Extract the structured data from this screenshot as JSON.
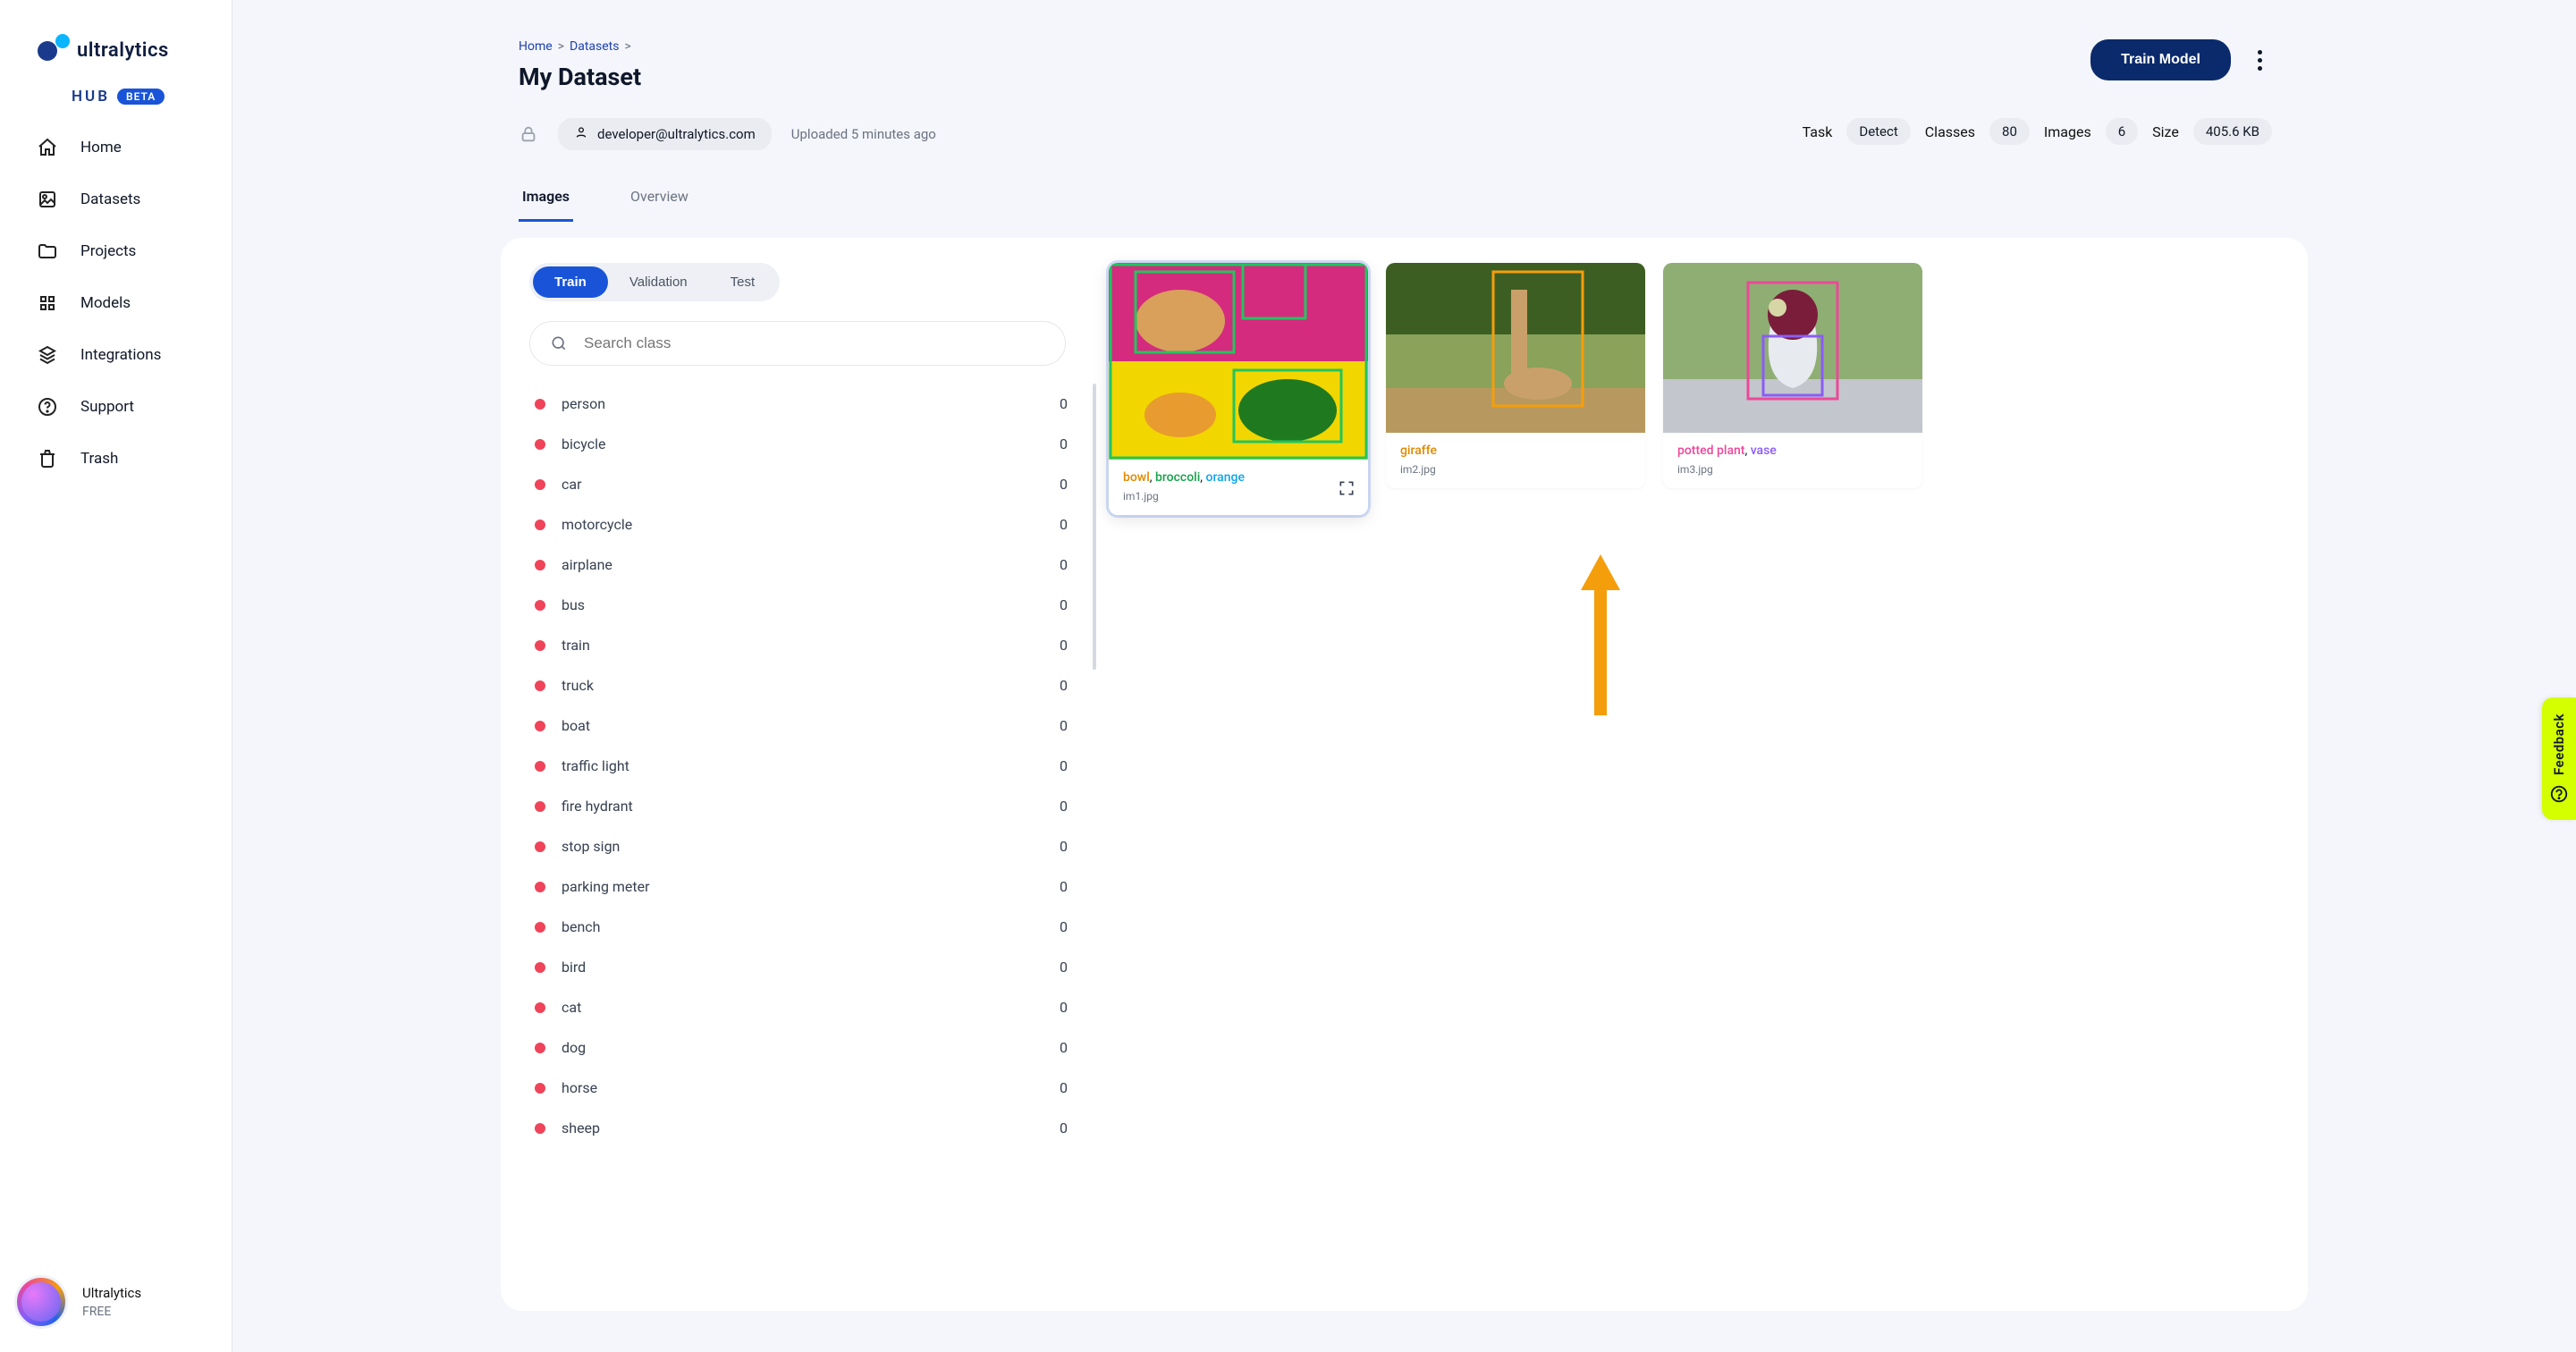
{
  "brand": {
    "name": "ultralytics",
    "hub": "HUB",
    "badge": "BETA"
  },
  "nav": [
    {
      "id": "home",
      "label": "Home"
    },
    {
      "id": "datasets",
      "label": "Datasets"
    },
    {
      "id": "projects",
      "label": "Projects"
    },
    {
      "id": "models",
      "label": "Models"
    },
    {
      "id": "integrations",
      "label": "Integrations"
    },
    {
      "id": "support",
      "label": "Support"
    },
    {
      "id": "trash",
      "label": "Trash"
    }
  ],
  "user": {
    "name": "Ultralytics",
    "plan": "FREE"
  },
  "breadcrumb": {
    "home": "Home",
    "datasets": "Datasets",
    "sep": ">"
  },
  "title": "My Dataset",
  "primary_button": "Train Model",
  "owner": {
    "email": "developer@ultralytics.com"
  },
  "uploaded": "Uploaded 5 minutes ago",
  "stats": {
    "task_label": "Task",
    "task_value": "Detect",
    "classes_label": "Classes",
    "classes_value": "80",
    "images_label": "Images",
    "images_value": "6",
    "size_label": "Size",
    "size_value": "405.6 KB"
  },
  "tabs": [
    {
      "id": "images",
      "label": "Images",
      "active": true
    },
    {
      "id": "overview",
      "label": "Overview",
      "active": false
    }
  ],
  "splits": [
    {
      "id": "train",
      "label": "Train",
      "active": true
    },
    {
      "id": "val",
      "label": "Validation",
      "active": false
    },
    {
      "id": "test",
      "label": "Test",
      "active": false
    }
  ],
  "search": {
    "placeholder": "Search class"
  },
  "classes": [
    {
      "name": "person",
      "count": 0
    },
    {
      "name": "bicycle",
      "count": 0
    },
    {
      "name": "car",
      "count": 0
    },
    {
      "name": "motorcycle",
      "count": 0
    },
    {
      "name": "airplane",
      "count": 0
    },
    {
      "name": "bus",
      "count": 0
    },
    {
      "name": "train",
      "count": 0
    },
    {
      "name": "truck",
      "count": 0
    },
    {
      "name": "boat",
      "count": 0
    },
    {
      "name": "traffic light",
      "count": 0
    },
    {
      "name": "fire hydrant",
      "count": 0
    },
    {
      "name": "stop sign",
      "count": 0
    },
    {
      "name": "parking meter",
      "count": 0
    },
    {
      "name": "bench",
      "count": 0
    },
    {
      "name": "bird",
      "count": 0
    },
    {
      "name": "cat",
      "count": 0
    },
    {
      "name": "dog",
      "count": 0
    },
    {
      "name": "horse",
      "count": 0
    },
    {
      "name": "sheep",
      "count": 0
    }
  ],
  "images": [
    {
      "file": "im1.jpg",
      "labels": [
        {
          "t": "bowl",
          "c": "#e08a00"
        },
        {
          "t": "broccoli",
          "c": "#16a34a"
        },
        {
          "t": "orange",
          "c": "#0ea5e9"
        }
      ],
      "active": true
    },
    {
      "file": "im2.jpg",
      "labels": [
        {
          "t": "giraffe",
          "c": "#e08a00"
        }
      ],
      "active": false
    },
    {
      "file": "im3.jpg",
      "labels": [
        {
          "t": "potted plant",
          "c": "#ec4899"
        },
        {
          "t": "vase",
          "c": "#8b5cf6"
        }
      ],
      "active": false
    }
  ],
  "feedback": "Feedback"
}
